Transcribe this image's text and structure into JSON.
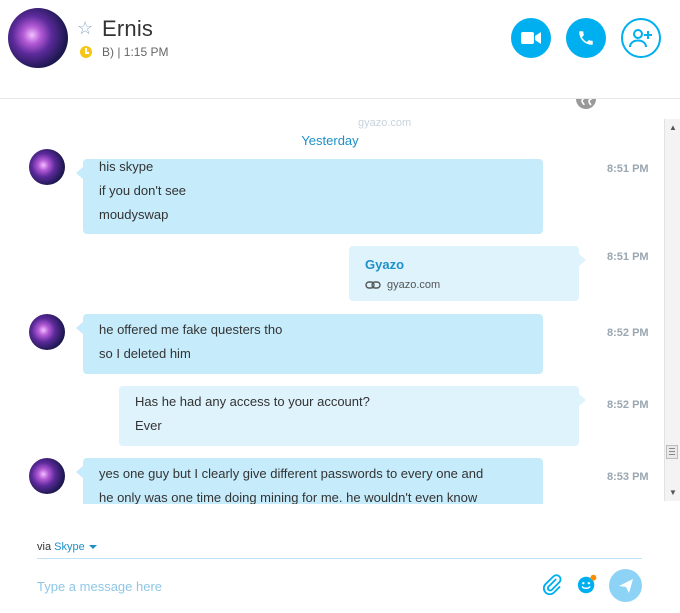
{
  "header": {
    "contact_name": "Ernis",
    "status_text": "B) | 1:15 PM",
    "icons": {
      "favorite": "star-outline-icon",
      "status": "clock-icon",
      "video": "video-camera-icon",
      "call": "phone-icon",
      "add": "add-person-icon"
    }
  },
  "chat": {
    "date_separator": "Yesterday",
    "partial_link_text": "gyazo.com",
    "messages": [
      {
        "direction": "incoming",
        "lines": [
          "his skype",
          "if you don't see",
          "moudyswap"
        ],
        "time": "8:51 PM"
      },
      {
        "direction": "outgoing",
        "link_title": "Gyazo",
        "link_url": "gyazo.com",
        "time": "8:51 PM"
      },
      {
        "direction": "incoming",
        "lines": [
          "he offered me fake questers tho",
          "so I deleted him"
        ],
        "time": "8:52 PM"
      },
      {
        "direction": "outgoing",
        "lines": [
          "Has he had any access to your account?",
          "Ever"
        ],
        "time": "8:52 PM"
      },
      {
        "direction": "incoming",
        "lines": [
          "yes one guy but I clearly give different passwords to every one and",
          "he only was one time doing mining for me. he wouldn't even know"
        ],
        "time": "8:53 PM"
      }
    ]
  },
  "composer": {
    "via_label": "via",
    "via_service": "Skype",
    "placeholder": "Type a message here",
    "icons": {
      "attach": "paperclip-icon",
      "emoji": "emoji-icon",
      "send": "send-icon"
    }
  },
  "colors": {
    "accent": "#00aff0",
    "incoming_bubble": "#c6ebfb",
    "outgoing_bubble": "#dff3fd",
    "link": "#1e90c8"
  }
}
